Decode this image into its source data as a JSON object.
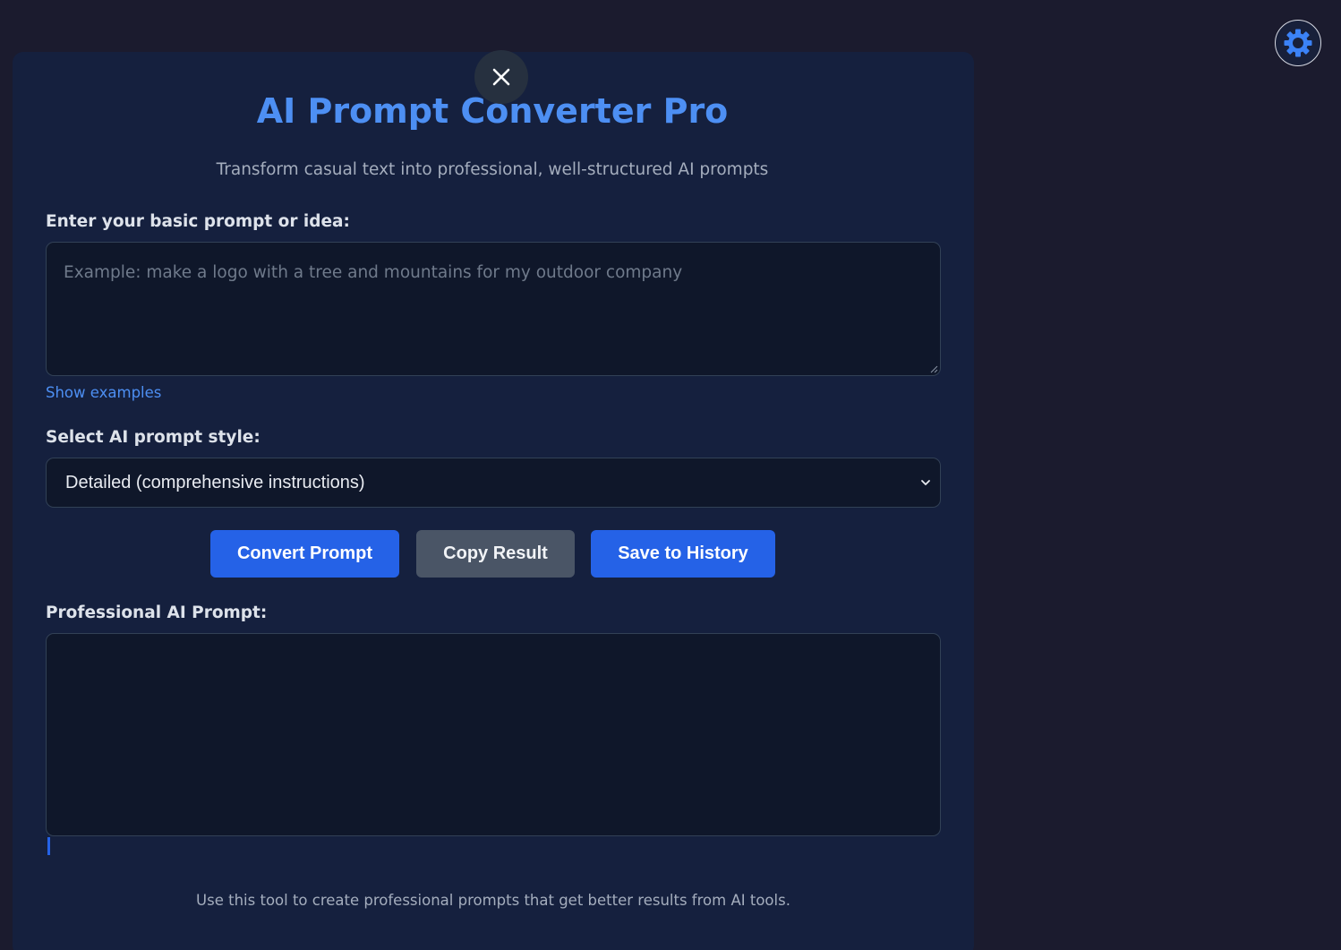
{
  "header": {
    "title": "AI Prompt Converter Pro",
    "subtitle": "Transform casual text into professional, well-structured AI prompts"
  },
  "icons": {
    "close": "close-icon",
    "theme": "gear-icon",
    "chevron": "chevron-down-icon"
  },
  "input": {
    "label": "Enter your basic prompt or idea:",
    "placeholder": "Example: make a logo with a tree and mountains for my outdoor company",
    "value": ""
  },
  "show_examples_label": "Show examples",
  "style": {
    "label": "Select AI prompt style:",
    "selected": "Detailed (comprehensive instructions)"
  },
  "buttons": {
    "convert": "Convert Prompt",
    "copy": "Copy Result",
    "save": "Save to History"
  },
  "output": {
    "label": "Professional AI Prompt:",
    "value": ""
  },
  "footer": "Use this tool to create professional prompts that get better results from AI tools.",
  "colors": {
    "page_background": "#1b1b2e",
    "panel_background": "#15203e",
    "accent": "#4d8ff3",
    "primary_button": "#2562e7",
    "secondary_button": "#4a5566"
  }
}
